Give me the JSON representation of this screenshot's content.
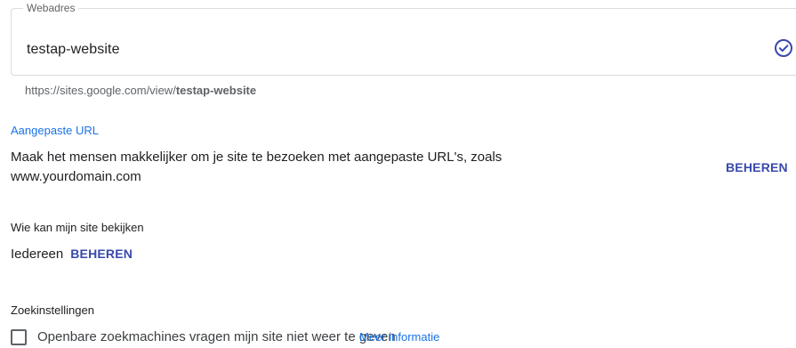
{
  "address_field": {
    "label": "Webadres",
    "value": "testap-website",
    "valid_icon": "check-circle-icon"
  },
  "helper": {
    "prefix": "https://sites.google.com/view/",
    "slug": "testap-website"
  },
  "custom_url": {
    "title": "Aangepaste URL",
    "description": "Maak het mensen makkelijker om je site te bezoeken met aangepaste URL's, zoals www.yourdomain.com",
    "manage_label": "BEHEREN"
  },
  "visibility": {
    "title": "Wie kan mijn site bekijken",
    "value": "Iedereen",
    "manage_label": "BEHEREN"
  },
  "search": {
    "title": "Zoekinstellingen",
    "checkbox_label": "Openbare zoekmachines vragen mijn site niet weer te geven",
    "checkbox_checked": false,
    "more_info": "Meer informatie"
  },
  "colors": {
    "accent": "#1a73e8",
    "action": "#3949ab",
    "border": "#dadce0"
  }
}
